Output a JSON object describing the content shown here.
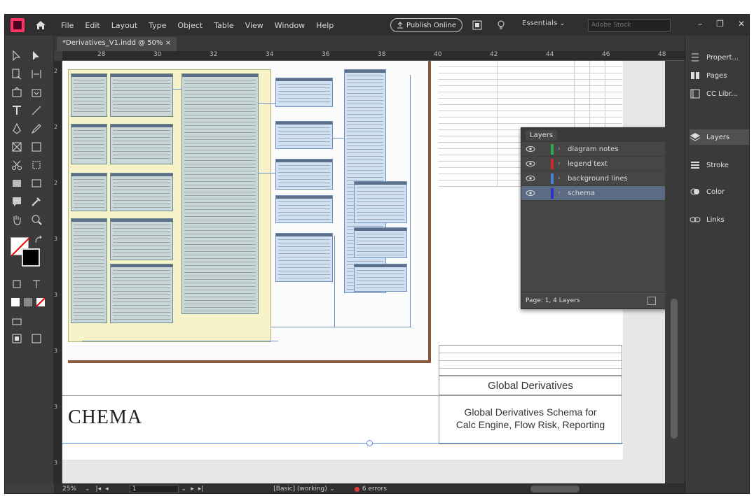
{
  "menubar": {
    "items": [
      "File",
      "Edit",
      "Layout",
      "Type",
      "Object",
      "Table",
      "View",
      "Window",
      "Help"
    ],
    "publish_label": "Publish Online",
    "workspace": "Essentials",
    "search_placeholder": "Adobe Stock"
  },
  "document": {
    "tab_label": "*Derivatives_V1.indd @ 50%"
  },
  "ruler": {
    "h_ticks": [
      "28",
      "30",
      "32",
      "34",
      "36",
      "38",
      "40",
      "42",
      "44",
      "46",
      "48"
    ],
    "v_ticks": [
      "2",
      "2",
      "2",
      "3",
      "3",
      "3",
      "3",
      "3"
    ]
  },
  "canvas": {
    "schema_title": "CHEMA",
    "title_block": "Global Derivatives",
    "subtitle_line1": "Global Derivatives Schema for",
    "subtitle_line2": "Calc Engine, Flow Risk, Reporting"
  },
  "status": {
    "zoom": "25%",
    "page": "1",
    "preflight_profile": "[Basic] (working)",
    "errors": "6 errors"
  },
  "dock": {
    "items": [
      "Propert...",
      "Pages",
      "CC Libr...",
      "Layers",
      "Stroke",
      "Color",
      "Links"
    ]
  },
  "layers_panel": {
    "title": "Layers",
    "layers": [
      {
        "name": "diagram notes",
        "color": "#2ea84a"
      },
      {
        "name": "legend text",
        "color": "#c92a2a"
      },
      {
        "name": "background lines",
        "color": "#4a7fd6"
      },
      {
        "name": "schema",
        "color": "#2a33c9"
      }
    ],
    "footer": "Page: 1, 4 Layers"
  },
  "colors": {
    "chrome_bg": "#3e3e3e",
    "accent_brand": "#ff3366",
    "selection": "#5b6b83"
  }
}
